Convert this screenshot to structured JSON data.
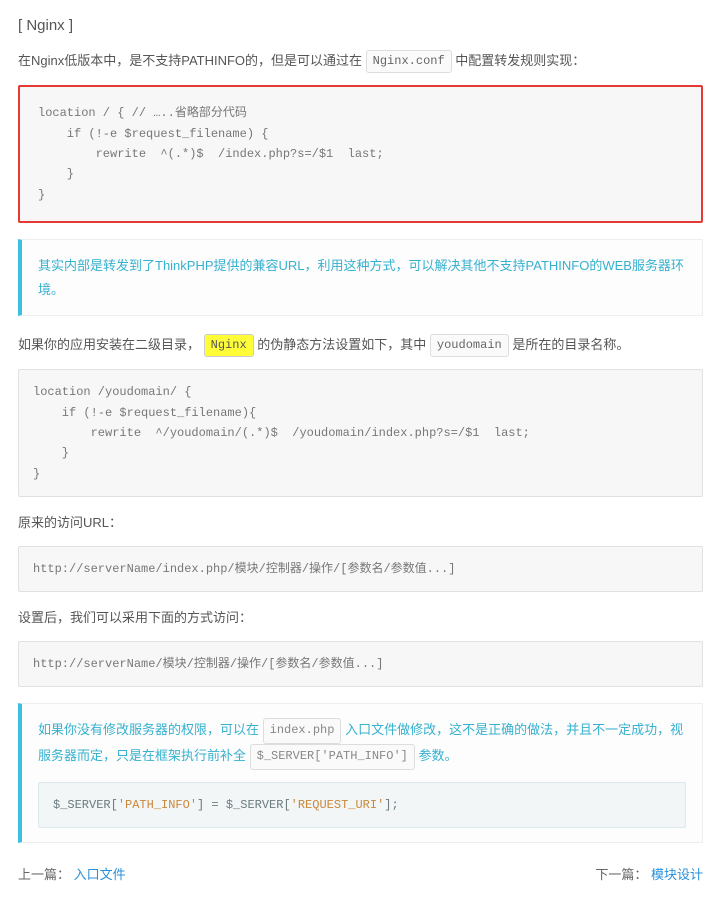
{
  "title": "[ Nginx ]",
  "para1": {
    "prefix": "在Nginx低版本中，是不支持PATHINFO的，但是可以通过在 ",
    "code": "Nginx.conf",
    "suffix": " 中配置转发规则实现："
  },
  "code1": "location / { // …..省略部分代码\n    if (!-e $request_filename) {\n        rewrite  ^(.*)$  /index.php?s=/$1  last;\n    }\n}",
  "callout1": "其实内部是转发到了ThinkPHP提供的兼容URL，利用这种方式，可以解决其他不支持PATHINFO的WEB服务器环境。",
  "para2": {
    "prefix": "如果你的应用安装在二级目录，",
    "code1": "Nginx",
    "mid": " 的伪静态方法设置如下，其中 ",
    "code2": "youdomain",
    "suffix": " 是所在的目录名称。"
  },
  "code2": "location /youdomain/ {\n    if (!-e $request_filename){\n        rewrite  ^/youdomain/(.*)$  /youdomain/index.php?s=/$1  last;\n    }\n}",
  "para3": "原来的访问URL：",
  "code3": "http://serverName/index.php/模块/控制器/操作/[参数名/参数值...]",
  "para4": "设置后，我们可以采用下面的方式访问：",
  "code4": "http://serverName/模块/控制器/操作/[参数名/参数值...]",
  "callout2": {
    "t1": "如果你没有修改服务器的权限，可以在 ",
    "code1": "index.php",
    "t2": " 入口文件做修改，这不是正确的做法，并且不一定成功，视服务器而定，只是在框架执行前补全 ",
    "code2": "$_SERVER['PATH_INFO']",
    "t3": " 参数。",
    "codeblock_prefix": "$_SERVER[",
    "codeblock_path": "'PATH_INFO'",
    "codeblock_mid": "] = $_SERVER[",
    "codeblock_req": "'REQUEST_URI'",
    "codeblock_suffix": "];"
  },
  "nav": {
    "prev_label": "上一篇：",
    "prev_link": "入口文件",
    "next_label": "下一篇：",
    "next_link": "模块设计"
  }
}
